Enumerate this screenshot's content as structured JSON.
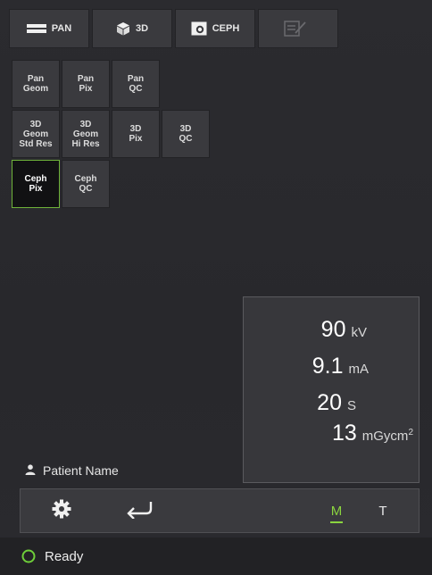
{
  "tabs": [
    {
      "label": "PAN",
      "icon": "pan-icon"
    },
    {
      "label": "3D",
      "icon": "cube-icon"
    },
    {
      "label": "CEPH",
      "icon": "ceph-icon"
    },
    {
      "label": "",
      "icon": "report-icon",
      "disabled": true
    }
  ],
  "tests": {
    "row1": [
      "Pan\nGeom",
      "Pan\nPix",
      "Pan\nQC"
    ],
    "row2": [
      "3D\nGeom\nStd Res",
      "3D\nGeom\nHi Res",
      "3D\nPix",
      "3D\nQC"
    ],
    "row3": [
      "Ceph\nPix",
      "Ceph\nQC"
    ],
    "selected": "Ceph\nPix"
  },
  "exposure": {
    "kv_value": "90",
    "kv_unit": "kV",
    "ma_value": "9.1",
    "ma_unit": "mA",
    "s_value": "20",
    "s_unit": "S",
    "dose_value": "13",
    "dose_unit": "mGycm",
    "dose_unit_sup": "2"
  },
  "patient": {
    "label": "Patient Name",
    "icon": "person-icon"
  },
  "toolbar": {
    "settings_icon": "gear-icon",
    "return_icon": "return-icon",
    "mode_m": "M",
    "mode_t": "T",
    "active_mode": "M",
    "accent_color": "#8bd43f"
  },
  "status": {
    "text": "Ready",
    "indicator_color": "#6fcf3a"
  }
}
